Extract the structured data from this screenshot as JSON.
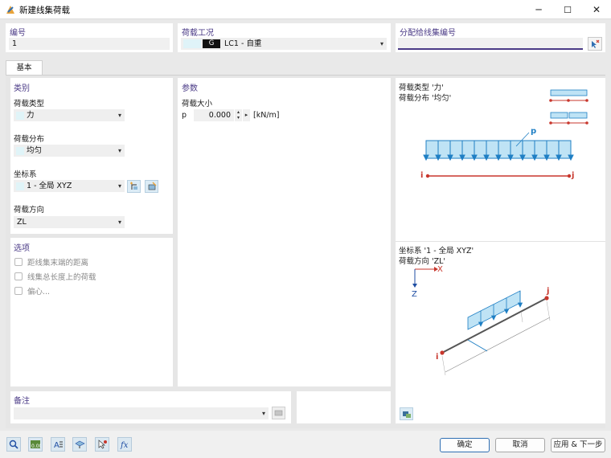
{
  "window": {
    "title": "新建线集荷载",
    "minimize": "─",
    "maximize": "☐",
    "close": "✕"
  },
  "header": {
    "number_label": "编号",
    "number_value": "1",
    "load_case_label": "荷载工况",
    "load_case_badge": "G",
    "load_case_value": "LC1 - 自重",
    "assign_label": "分配给线集编号"
  },
  "tabs": [
    {
      "label": "基本"
    }
  ],
  "category": {
    "title": "类别",
    "load_type_label": "荷载类型",
    "load_type_value": "力",
    "load_distribution_label": "荷载分布",
    "load_distribution_value": "均匀",
    "coord_system_label": "坐标系",
    "coord_system_value": "1 - 全局 XYZ",
    "load_direction_label": "荷载方向",
    "load_direction_value": "ZL"
  },
  "options": {
    "title": "选项",
    "items": [
      {
        "label": "距线集末端的距离",
        "checked": false
      },
      {
        "label": "线集总长度上的荷载",
        "checked": false
      },
      {
        "label": "偏心...",
        "checked": false
      }
    ]
  },
  "parameters": {
    "title": "参数",
    "magnitude_label": "荷载大小",
    "symbol": "p",
    "value": "0.000",
    "unit": "[kN/m]"
  },
  "preview_top": {
    "line1": "荷载类型 '力'",
    "line2": "荷载分布 '均匀'",
    "p_label": "p",
    "i_label": "i",
    "j_label": "j"
  },
  "preview_bottom": {
    "line1": "坐标系 '1 - 全局 XYZ'",
    "line2": "荷载方向 'ZL'",
    "x_label": "X",
    "z_label": "Z",
    "i_label": "i",
    "j_label": "j"
  },
  "comment": {
    "title": "备注"
  },
  "footer": {
    "ok": "确定",
    "cancel": "取消",
    "apply_next": "应用 & 下一步"
  },
  "colors": {
    "accent": "#4a3a86",
    "load_fill": "#bfe3f5",
    "load_stroke": "#1f7fc4",
    "member": "#c8372d"
  }
}
